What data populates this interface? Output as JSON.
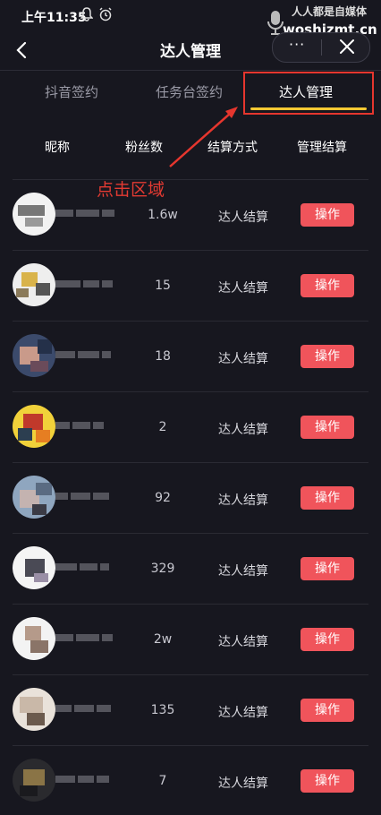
{
  "status_bar": {
    "time": "上午11:35"
  },
  "watermark": {
    "line1": "人人都是自媒体",
    "line2": "woshizmt.cn"
  },
  "header": {
    "title": "达人管理",
    "more_label": "···"
  },
  "tabs": [
    {
      "label": "抖音签约"
    },
    {
      "label": "任务台签约"
    },
    {
      "label": "达人管理",
      "active": true
    }
  ],
  "annotation": {
    "text": "点击区域",
    "color": "#e6362e"
  },
  "columns": [
    "昵称",
    "粉丝数",
    "结算方式",
    "管理结算"
  ],
  "rows": [
    {
      "fans": "1.6w",
      "settle": "达人结算",
      "action": "操作"
    },
    {
      "fans": "15",
      "settle": "达人结算",
      "action": "操作"
    },
    {
      "fans": "18",
      "settle": "达人结算",
      "action": "操作"
    },
    {
      "fans": "2",
      "settle": "达人结算",
      "action": "操作"
    },
    {
      "fans": "92",
      "settle": "达人结算",
      "action": "操作"
    },
    {
      "fans": "329",
      "settle": "达人结算",
      "action": "操作"
    },
    {
      "fans": "2w",
      "settle": "达人结算",
      "action": "操作"
    },
    {
      "fans": "135",
      "settle": "达人结算",
      "action": "操作"
    },
    {
      "fans": "7",
      "settle": "达人结算",
      "action": "操作"
    }
  ],
  "colors": {
    "background": "#17171f",
    "accent": "#f6c933",
    "button": "#f0545b",
    "annotation": "#e6362e"
  }
}
